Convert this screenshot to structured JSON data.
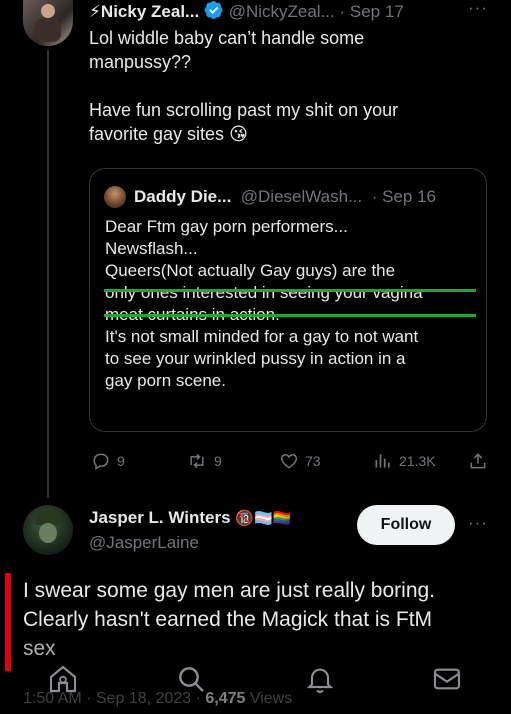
{
  "colors": {
    "background": "#000000",
    "text": "#e7e9ea",
    "muted": "#71767b",
    "verified": "#1d9bf0",
    "follow_bg": "#eff3f4",
    "highlight_underline": "#1fa637",
    "red_marker": "#e0000b"
  },
  "tweet1": {
    "display_name": "⚡Nicky Zeal...",
    "handle": "@NickyZeal...",
    "separator": "·",
    "date": "Sep 17",
    "more": "···",
    "text_line1": "Lol widdle baby can’t handle some",
    "text_line2": "manpussy??",
    "text_line3": "Have fun scrolling past my shit on your",
    "text_line4": "favorite gay sites 😘",
    "quote": {
      "display_name": "Daddy Die...",
      "handle": "@DieselWash...",
      "separator": "·",
      "date": "Sep 16",
      "lines": [
        "Dear Ftm gay porn performers...",
        "Newsflash...",
        "Queers(Not actually Gay guys) are the",
        "only ones interested in seeing your vagina",
        "meat curtains in action.",
        "It's not small minded for a gay to not want",
        "to see your wrinkled pussy in action in a",
        "gay porn scene."
      ]
    },
    "actions": {
      "replies": "9",
      "reposts": "9",
      "likes": "73",
      "views": "21.3K"
    }
  },
  "tweet2": {
    "display_name": "Jasper L. Winters",
    "badges": "🔞🏳️‍⚧️🏳️‍🌈",
    "handle": "@JasperLaine",
    "follow_label": "Follow",
    "more": "···",
    "text_line1": "I swear some gay men are just really boring.",
    "text_line2": "Clearly hasn't earned the Magick that is FtM",
    "text_line3": "sex",
    "meta_time": "1:50 AM · Sep 18, 2023 · ",
    "meta_views_count": "6,475",
    "meta_views_label": " Views"
  },
  "icons": [
    "verified-icon",
    "reply-icon",
    "repost-icon",
    "like-icon",
    "views-icon",
    "share-icon",
    "home-icon",
    "search-icon",
    "notifications-icon",
    "messages-icon"
  ]
}
